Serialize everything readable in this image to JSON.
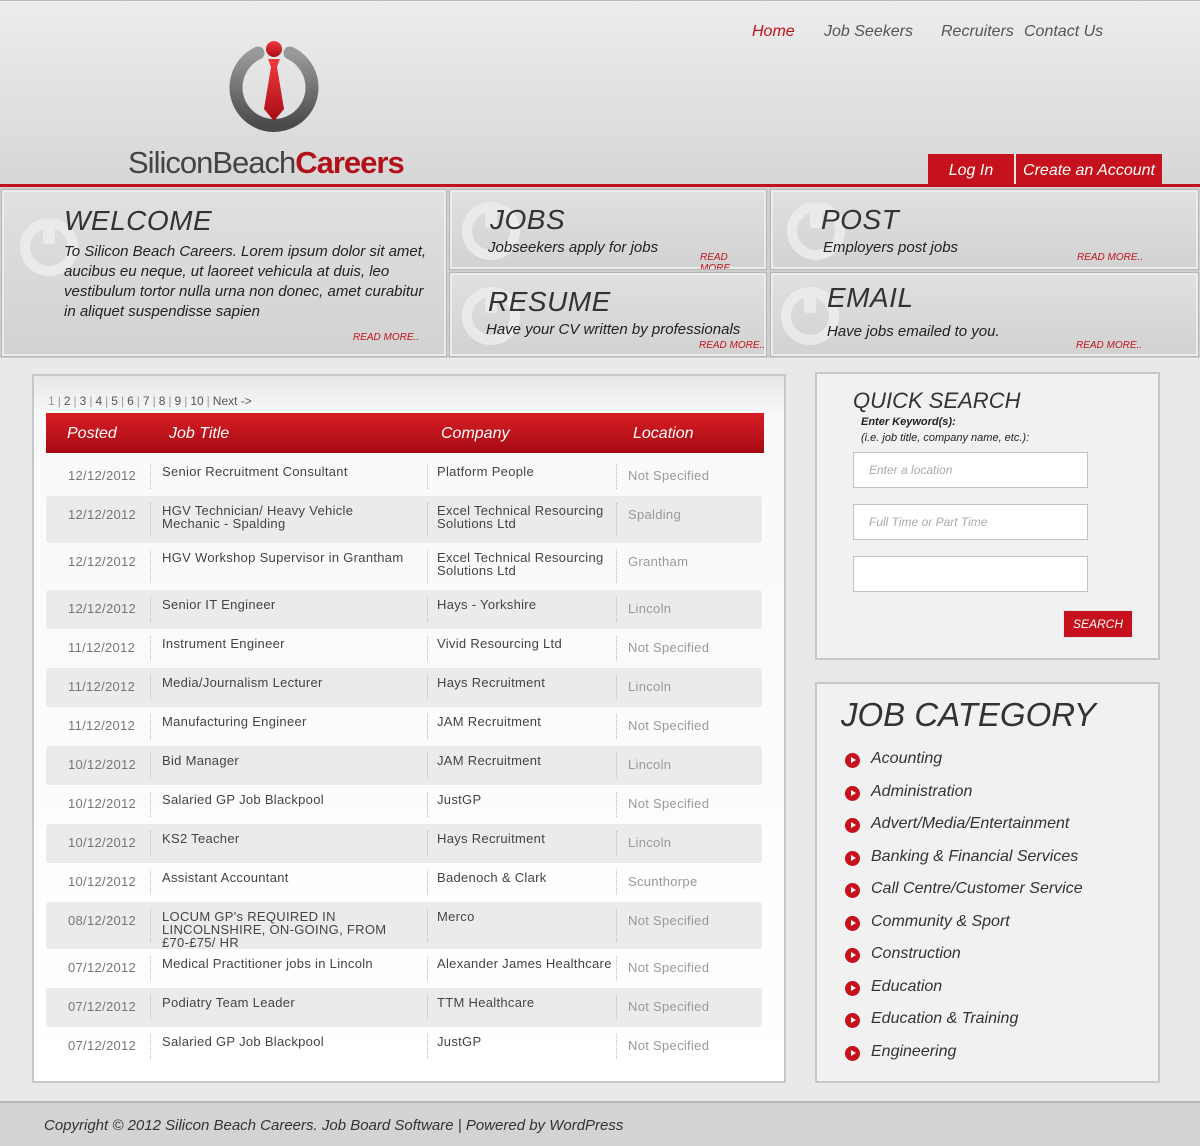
{
  "brand": {
    "name_part1": "SiliconBeach",
    "name_part2": "Careers",
    "colors": {
      "accent": "#c1121b",
      "logo_ring": "#666666"
    }
  },
  "nav": {
    "items": [
      {
        "label": "Home",
        "active": true
      },
      {
        "label": "Job Seekers"
      },
      {
        "label": "Recruiters"
      },
      {
        "label": "Contact Us"
      }
    ]
  },
  "auth": {
    "login": "Log In",
    "create": "Create an Account"
  },
  "features": {
    "welcome": {
      "title": "WELCOME",
      "text": "To Silicon Beach Careers.  Lorem ipsum dolor sit amet, aucibus eu neque, ut laoreet vehicula at duis, leo vestibulum tortor nulla urna non donec, amet curabitur in aliquet suspendisse sapien",
      "more": "READ MORE.."
    },
    "jobs": {
      "title": "JOBS",
      "text": "Jobseekers apply for jobs",
      "more": "READ MORE.."
    },
    "post": {
      "title": "POST",
      "text": "Employers post jobs",
      "more": "READ MORE.."
    },
    "resume": {
      "title": "RESUME",
      "text": "Have your CV written by professionals",
      "more": "READ MORE.."
    },
    "email": {
      "title": "EMAIL",
      "text": "Have jobs emailed to you.",
      "more": "READ MORE.."
    }
  },
  "pager": {
    "current": "1",
    "pages": [
      "2",
      "3",
      "4",
      "5",
      "6",
      "7",
      "8",
      "9",
      "10"
    ],
    "next": "Next ->"
  },
  "table": {
    "headers": {
      "posted": "Posted",
      "title": "Job Title",
      "company": "Company",
      "location": "Location"
    },
    "rows": [
      {
        "posted": "12/12/2012",
        "title": "Senior Recruitment Consultant",
        "company": "Platform People",
        "location": "Not Specified"
      },
      {
        "posted": "12/12/2012",
        "title": "HGV Technician/ Heavy Vehicle Mechanic - Spalding",
        "company": "Excel Technical Resourcing Solutions Ltd",
        "location": "Spalding"
      },
      {
        "posted": "12/12/2012",
        "title": "HGV Workshop Supervisor in Grantham",
        "company": "Excel Technical Resourcing Solutions Ltd",
        "location": "Grantham"
      },
      {
        "posted": "12/12/2012",
        "title": "Senior IT Engineer",
        "company": "Hays - Yorkshire",
        "location": "Lincoln"
      },
      {
        "posted": "11/12/2012",
        "title": "Instrument Engineer",
        "company": "Vivid Resourcing Ltd",
        "location": "Not Specified"
      },
      {
        "posted": "11/12/2012",
        "title": "Media/Journalism Lecturer",
        "company": "Hays Recruitment",
        "location": "Lincoln"
      },
      {
        "posted": "11/12/2012",
        "title": "Manufacturing Engineer",
        "company": "JAM Recruitment",
        "location": "Not Specified"
      },
      {
        "posted": "10/12/2012",
        "title": "Bid Manager",
        "company": "JAM Recruitment",
        "location": "Lincoln"
      },
      {
        "posted": "10/12/2012",
        "title": "Salaried GP Job Blackpool",
        "company": "JustGP",
        "location": "Not Specified"
      },
      {
        "posted": "10/12/2012",
        "title": "KS2 Teacher",
        "company": "Hays Recruitment",
        "location": "Lincoln"
      },
      {
        "posted": "10/12/2012",
        "title": "Assistant Accountant",
        "company": "Badenoch & Clark",
        "location": "Scunthorpe"
      },
      {
        "posted": "08/12/2012",
        "title": "LOCUM GP's REQUIRED IN LINCOLNSHIRE, ON-GOING, FROM £70-£75/ HR",
        "company": "Merco",
        "location": "Not Specified"
      },
      {
        "posted": "07/12/2012",
        "title": "Medical Practitioner jobs in Lincoln",
        "company": "Alexander James Healthcare",
        "location": "Not Specified"
      },
      {
        "posted": "07/12/2012",
        "title": "Podiatry Team Leader",
        "company": "TTM Healthcare",
        "location": "Not Specified"
      },
      {
        "posted": "07/12/2012",
        "title": "Salaried GP Job Blackpool",
        "company": "JustGP",
        "location": "Not Specified"
      }
    ]
  },
  "search": {
    "title": "QUICK SEARCH",
    "label": "Enter Keyword(s):",
    "hint": "(i.e. job title, company name, etc.):",
    "location_placeholder": "Enter a location",
    "type_placeholder": "Full Time or Part Time",
    "extra_value": "",
    "button": "SEARCH"
  },
  "categories": {
    "title": "JOB CATEGORY",
    "items": [
      "Acounting",
      "Administration",
      "Advert/Media/Entertainment",
      "Banking & Financial Services",
      "Call Centre/Customer Service",
      "Community & Sport",
      "Construction",
      "Education",
      "Education & Training",
      "Engineering"
    ],
    "bullet_icon": "play-circle-icon"
  },
  "footer": {
    "text": "Copyright © 2012 Silicon Beach Careers. Job Board Software | Powered by WordPress"
  }
}
